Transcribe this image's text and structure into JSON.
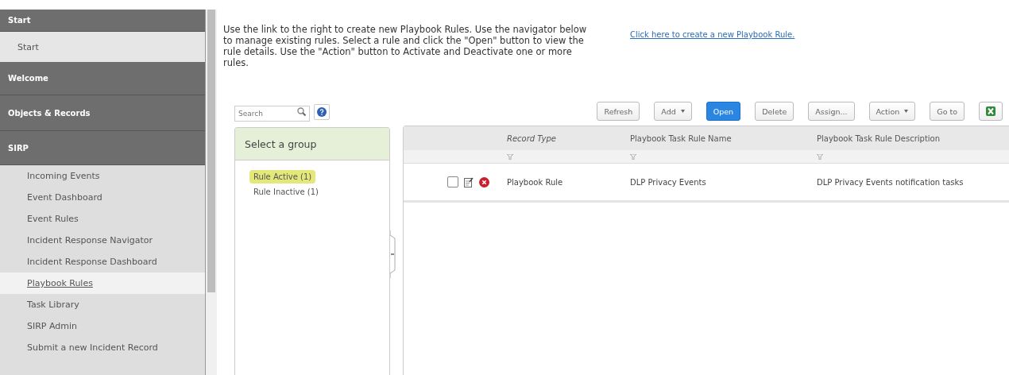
{
  "sidebar": {
    "sections": [
      {
        "title": "Start",
        "items": [
          {
            "label": "Start",
            "selected": false
          }
        ]
      },
      {
        "title": "Welcome"
      },
      {
        "title": "Objects & Records"
      },
      {
        "title": "SIRP",
        "items": [
          {
            "label": "Incoming Events",
            "selected": false
          },
          {
            "label": "Event Dashboard",
            "selected": false
          },
          {
            "label": "Event Rules",
            "selected": false
          },
          {
            "label": "Incident Response Navigator",
            "selected": false
          },
          {
            "label": "Incident Response Dashboard",
            "selected": false
          },
          {
            "label": "Playbook Rules",
            "selected": true
          },
          {
            "label": "Task Library",
            "selected": false
          },
          {
            "label": "SIRP Admin",
            "selected": false
          },
          {
            "label": "Submit a new Incident Record",
            "selected": false
          }
        ]
      }
    ]
  },
  "intro": "Use the link to the right to create new Playbook Rules.  Use the navigator below to manage existing rules.  Select a rule and click the \"Open\" button to view the rule details.  Use the \"Action\" button to Activate and Deactivate one or more rules.",
  "create_link": "Click here to create a new Playbook Rule.",
  "search": {
    "placeholder": "Search"
  },
  "toolbar": [
    {
      "label": "Refresh",
      "kind": "plain"
    },
    {
      "label": "Add",
      "kind": "dropdown"
    },
    {
      "label": "Open",
      "kind": "primary"
    },
    {
      "label": "Delete",
      "kind": "plain"
    },
    {
      "label": "Assign...",
      "kind": "plain"
    },
    {
      "label": "Action",
      "kind": "dropdown"
    },
    {
      "label": "Go to",
      "kind": "plain"
    },
    {
      "kind": "export"
    }
  ],
  "groups": {
    "title": "Select a group",
    "items": [
      {
        "label": "Rule Active (1)",
        "selected": true
      },
      {
        "label": "Rule Inactive (1)",
        "selected": false
      }
    ]
  },
  "table": {
    "columns": [
      "Record Type",
      "Playbook Task Rule Name",
      "Playbook Task Rule Description"
    ],
    "rows": [
      {
        "checked": false,
        "cells": [
          "Playbook Rule",
          "DLP Privacy Events",
          "DLP Privacy Events notification tasks"
        ]
      }
    ]
  }
}
